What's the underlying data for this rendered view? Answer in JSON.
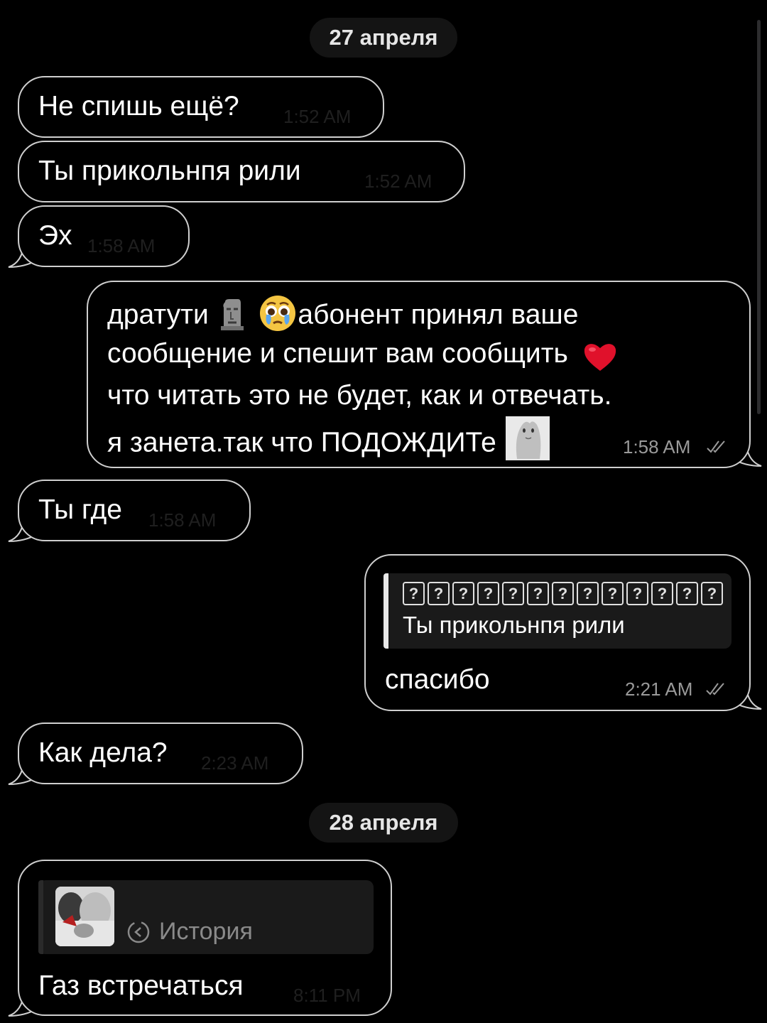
{
  "dates": {
    "first": "27 апреля",
    "second": "28 апреля"
  },
  "messages": [
    {
      "text": "Не спишь ещё?",
      "time": "1:52 AM"
    },
    {
      "text": "Ты прикольнпя рили",
      "time": "1:52 AM"
    },
    {
      "text": "Эх",
      "time": "1:58 AM"
    },
    {
      "lines": [
        "дратути",
        "абонент принял ваше",
        "сообщение и спешит вам сообщить",
        "что читать это не будет, как и отвечать.",
        "я занета.так что ПОДОЖДИТе"
      ],
      "time": "1:58 AM",
      "icons": [
        "moai-emoji",
        "pleading-tears-emoji",
        "red-heart-emoji",
        "seal-sticker",
        "read-checks-icon"
      ]
    },
    {
      "text": "Ты где",
      "time": "1:58 AM"
    },
    {
      "reply_header_glyph": "?",
      "reply_header_count": 13,
      "reply_text": "Ты прикольнпя рили",
      "text": "спасибо",
      "time": "2:21 AM"
    },
    {
      "text": "Как дела?",
      "time": "2:23 AM"
    },
    {
      "story_label": "История",
      "story_icon": "story-reply-icon",
      "text": "Газ встречаться",
      "time": "8:11 PM"
    }
  ],
  "colors": {
    "background": "#000000",
    "bubble_border": "#cfcfcf",
    "date_pill": "#141414",
    "quote_bg": "#1a1a1a"
  }
}
